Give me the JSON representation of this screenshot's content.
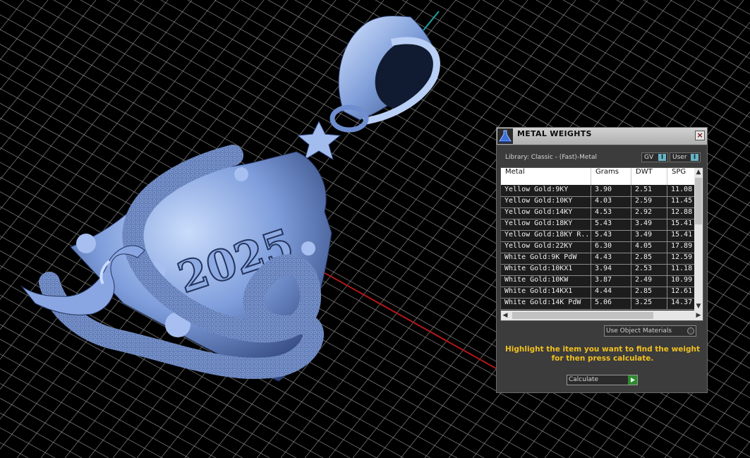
{
  "colors": {
    "model": "#7a99d6",
    "grid": "#8a8a8a",
    "axis_x": "#b01818",
    "axis_y": "#1fa3a3",
    "panel_bg": "#3c3c3c",
    "hint_text": "#f0c020"
  },
  "viewport": {
    "model_text": "2025"
  },
  "panel": {
    "title": "METAL WEIGHTS",
    "close_label": "×",
    "app_icon": "flask-icon",
    "library_label": "Library: Classic - (Fast)-Metal",
    "toggles": {
      "gv": {
        "label": "GV",
        "indicator": "I"
      },
      "user": {
        "label": "User",
        "indicator": "I"
      }
    },
    "table": {
      "columns": [
        "Metal",
        "Grams",
        "DWT",
        "SPG"
      ],
      "rows": [
        {
          "metal": "Yellow Gold:9KY",
          "grams": "3.90",
          "dwt": "2.51",
          "spg": "11.08"
        },
        {
          "metal": "Yellow Gold:10KY",
          "grams": "4.03",
          "dwt": "2.59",
          "spg": "11.45"
        },
        {
          "metal": "Yellow Gold:14KY",
          "grams": "4.53",
          "dwt": "2.92",
          "spg": "12.88"
        },
        {
          "metal": "Yellow Gold:18KY",
          "grams": "5.43",
          "dwt": "3.49",
          "spg": "15.41"
        },
        {
          "metal": "Yellow Gold:18KY R...",
          "grams": "5.43",
          "dwt": "3.49",
          "spg": "15.41"
        },
        {
          "metal": "Yellow Gold:22KY",
          "grams": "6.30",
          "dwt": "4.05",
          "spg": "17.89"
        },
        {
          "metal": "White Gold:9K PdW",
          "grams": "4.43",
          "dwt": "2.85",
          "spg": "12.59"
        },
        {
          "metal": "White Gold:10KX1",
          "grams": "3.94",
          "dwt": "2.53",
          "spg": "11.18"
        },
        {
          "metal": "White Gold:10KW",
          "grams": "3.87",
          "dwt": "2.49",
          "spg": "10.99"
        },
        {
          "metal": "White Gold:14KX1",
          "grams": "4.44",
          "dwt": "2.85",
          "spg": "12.61"
        },
        {
          "metal": "White Gold:14K PdW",
          "grams": "5.06",
          "dwt": "3.25",
          "spg": "14.37"
        }
      ]
    },
    "use_object_materials": "Use Object Materials",
    "hint": "Highlight the item you want to find the weight for then press calculate.",
    "calculate_label": "Calculate"
  }
}
